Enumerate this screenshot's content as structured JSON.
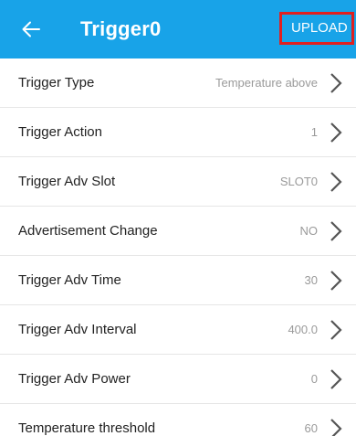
{
  "header": {
    "title": "Trigger0",
    "upload_label": "UPLOAD",
    "background_color": "#18a3e8",
    "highlight_color": "#e02020"
  },
  "settings": [
    {
      "label": "Trigger Type",
      "value": "Temperature above"
    },
    {
      "label": "Trigger Action",
      "value": "1"
    },
    {
      "label": "Trigger Adv Slot",
      "value": "SLOT0"
    },
    {
      "label": "Advertisement Change",
      "value": "NO"
    },
    {
      "label": "Trigger Adv Time",
      "value": "30"
    },
    {
      "label": "Trigger Adv Interval",
      "value": "400.0"
    },
    {
      "label": "Trigger Adv Power",
      "value": "0"
    },
    {
      "label": "Temperature threshold",
      "value": "60"
    }
  ]
}
